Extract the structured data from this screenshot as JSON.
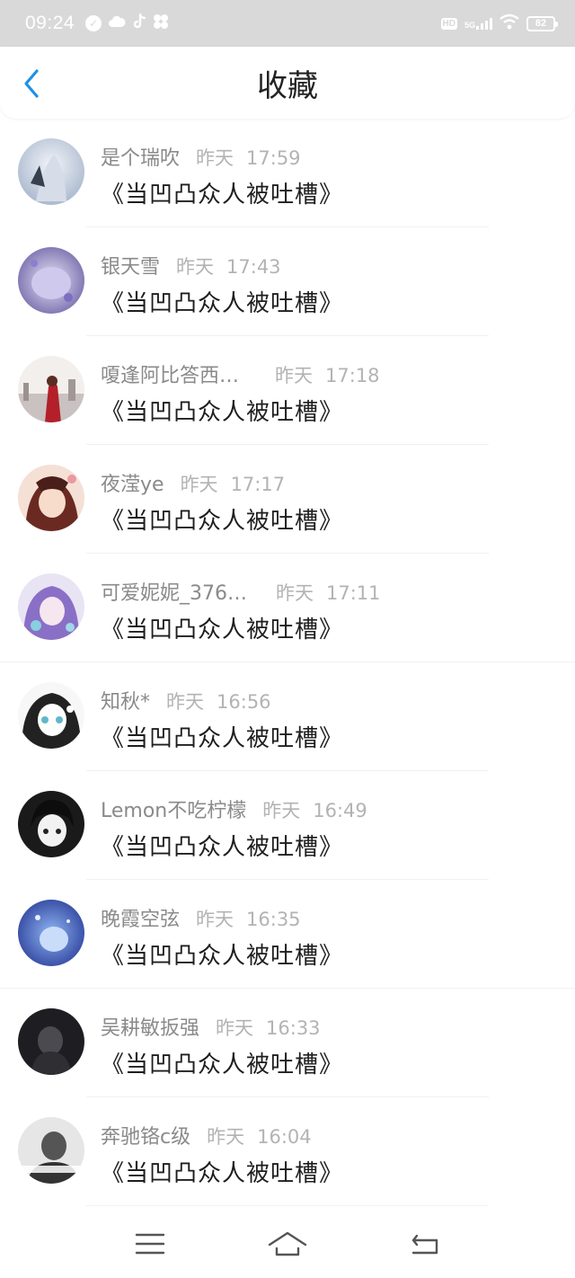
{
  "status_bar": {
    "time": "09:24",
    "network": "5G",
    "hd": "HD",
    "battery": "82"
  },
  "header": {
    "title": "收藏"
  },
  "favorites": [
    {
      "name": "是个瑞吹",
      "day": "昨天",
      "time": "17:59",
      "content": "《当凹凸众人被吐槽》"
    },
    {
      "name": "银天雪",
      "day": "昨天",
      "time": "17:43",
      "content": "《当凹凸众人被吐槽》"
    },
    {
      "name": "嗄逢阿比答西…",
      "day": "昨天",
      "time": "17:18",
      "content": "《当凹凸众人被吐槽》"
    },
    {
      "name": "夜滢ye",
      "day": "昨天",
      "time": "17:17",
      "content": "《当凹凸众人被吐槽》"
    },
    {
      "name": "可爱妮妮_376…",
      "day": "昨天",
      "time": "17:11",
      "content": "《当凹凸众人被吐槽》"
    },
    {
      "name": "知秋*",
      "day": "昨天",
      "time": "16:56",
      "content": "《当凹凸众人被吐槽》"
    },
    {
      "name": "Lemon不吃柠檬",
      "day": "昨天",
      "time": "16:49",
      "content": "《当凹凸众人被吐槽》"
    },
    {
      "name": "晚霞空弦",
      "day": "昨天",
      "time": "16:35",
      "content": "《当凹凸众人被吐槽》"
    },
    {
      "name": "吴耕敏扳强",
      "day": "昨天",
      "time": "16:33",
      "content": "《当凹凸众人被吐槽》"
    },
    {
      "name": "奔驰铬c级",
      "day": "昨天",
      "time": "16:04",
      "content": "《当凹凸众人被吐槽》"
    }
  ],
  "colors": {
    "accent": "#1e90e8",
    "status_bar_bg": "#d9d9d9",
    "name": "#8a8a8a",
    "time": "#b3b3b3",
    "content": "#1e1e1e"
  },
  "icons": {
    "back": "chevron-left-icon",
    "nav_menu": "menu-icon",
    "nav_home": "home-icon",
    "nav_back": "return-icon"
  }
}
